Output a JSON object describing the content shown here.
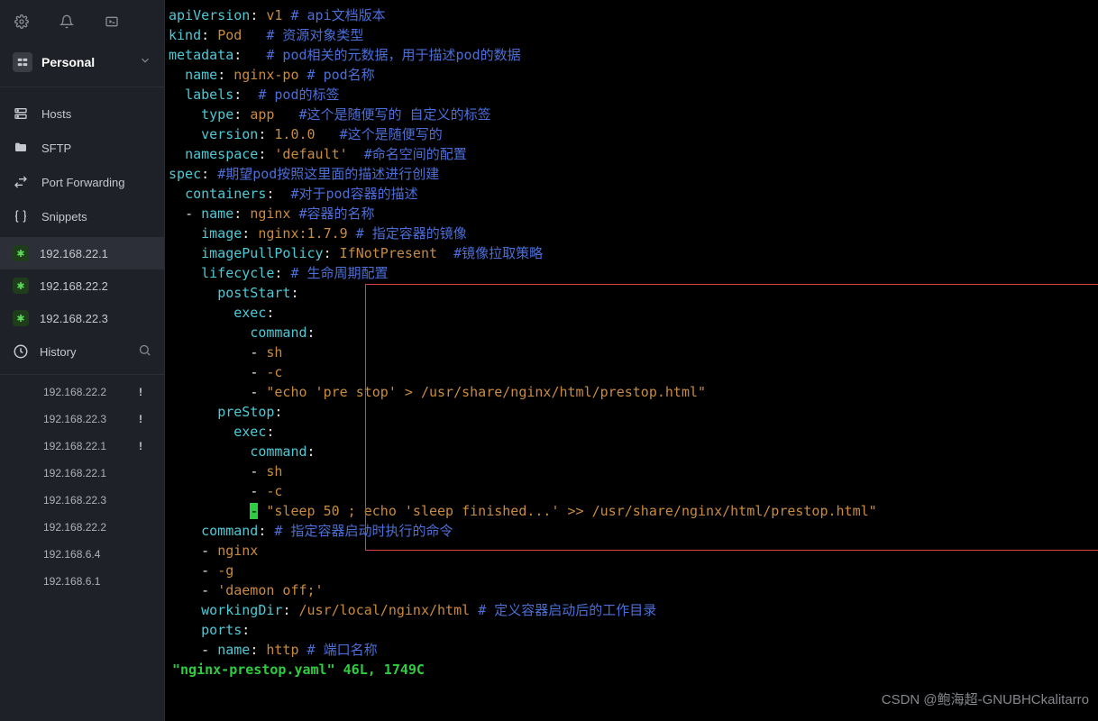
{
  "workspace": {
    "label": "Personal"
  },
  "nav": {
    "hosts": "Hosts",
    "sftp": "SFTP",
    "portfwd": "Port Forwarding",
    "snippets": "Snippets",
    "history": "History"
  },
  "hosts": {
    "items": [
      {
        "ip": "192.168.22.1",
        "active": true
      },
      {
        "ip": "192.168.22.2",
        "active": false
      },
      {
        "ip": "192.168.22.3",
        "active": false
      }
    ]
  },
  "recent": {
    "items": [
      {
        "ip": "192.168.22.2",
        "bang": "!"
      },
      {
        "ip": "192.168.22.3",
        "bang": "!"
      },
      {
        "ip": "192.168.22.1",
        "bang": "!"
      },
      {
        "ip": "192.168.22.1",
        "bang": ""
      },
      {
        "ip": "192.168.22.3",
        "bang": ""
      },
      {
        "ip": "192.168.22.2",
        "bang": ""
      },
      {
        "ip": "192.168.6.4",
        "bang": ""
      },
      {
        "ip": "192.168.6.1",
        "bang": ""
      }
    ]
  },
  "yaml": {
    "l1": {
      "k": "apiVersion",
      "v": "v1",
      "c": "# api文档版本"
    },
    "l2": {
      "k": "kind",
      "v": "Pod",
      "c": "# 资源对象类型"
    },
    "l3": {
      "k": "metadata",
      "c": "# pod相关的元数据，用于描述pod的数据"
    },
    "l4": {
      "k": "name",
      "v": "nginx-po",
      "c": "# pod名称"
    },
    "l5": {
      "k": "labels",
      "c": "# pod的标签"
    },
    "l6": {
      "k": "type",
      "v": "app",
      "c": "#这个是随便写的 自定义的标签"
    },
    "l7": {
      "k": "version",
      "v": "1.0.0",
      "c": "#这个是随便写的"
    },
    "l8": {
      "k": "namespace",
      "v": "'default'",
      "c": "#命名空间的配置"
    },
    "l9": {
      "k": "spec",
      "c": "#期望pod按照这里面的描述进行创建"
    },
    "l10": {
      "k": "containers",
      "c": "#对于pod容器的描述"
    },
    "l11": {
      "k": "name",
      "v": "nginx",
      "c": "#容器的名称"
    },
    "l12": {
      "k": "image",
      "v": "nginx:1.7.9",
      "c": "# 指定容器的镜像"
    },
    "l13": {
      "k": "imagePullPolicy",
      "v": "IfNotPresent",
      "c": "#镜像拉取策略"
    },
    "l14": {
      "k": "lifecycle",
      "c": "# 生命周期配置"
    },
    "l15": {
      "k": "postStart"
    },
    "l16": {
      "k": "exec"
    },
    "l17": {
      "k": "command"
    },
    "l18": {
      "v": "sh"
    },
    "l19": {
      "v": "-c"
    },
    "l20": {
      "v": "\"echo 'pre stop' > /usr/share/nginx/html/prestop.html\""
    },
    "l21": {
      "k": "preStop"
    },
    "l22": {
      "k": "exec"
    },
    "l23": {
      "k": "command"
    },
    "l24": {
      "v": "sh"
    },
    "l25": {
      "v": "-c"
    },
    "l26": {
      "v": "\"sleep 50 ; echo 'sleep finished...' >> /usr/share/nginx/html/prestop.html\""
    },
    "l27": {
      "k": "command",
      "c": "# 指定容器启动时执行的命令"
    },
    "l28": {
      "v": "nginx"
    },
    "l29": {
      "v": "-g"
    },
    "l30": {
      "v": "'daemon off;'"
    },
    "l31": {
      "k": "workingDir",
      "v": "/usr/local/nginx/html",
      "c": "# 定义容器启动后的工作目录"
    },
    "l32": {
      "k": "ports"
    },
    "l33": {
      "k": "name",
      "v": "http",
      "c": "# 端口名称"
    }
  },
  "status": "\"nginx-prestop.yaml\" 46L, 1749C",
  "watermark": "CSDN @鲍海超-GNUBHCkalitarro"
}
